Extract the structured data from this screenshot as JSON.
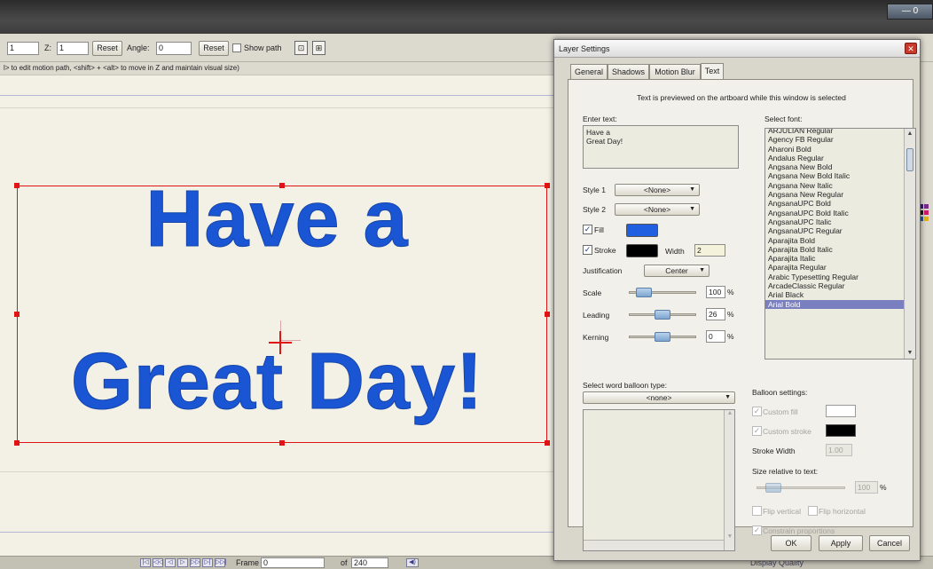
{
  "window": {
    "minimize_glyph": "—",
    "restore_glyph": "0"
  },
  "toolbar": {
    "field_1_value": "1",
    "z_label": "Z:",
    "z_value": "1",
    "reset_label": "Reset",
    "angle_label": "Angle:",
    "angle_value": "0",
    "reset2_label": "Reset",
    "show_path_label": "Show path",
    "hint": "l> to edit motion path, <shift> + <alt> to move in Z and maintain visual size)"
  },
  "artboard": {
    "line1": "Have a",
    "line2": "Great Day!",
    "text_color": "#1a55d4",
    "selection_color": "#e01414"
  },
  "playback": {
    "frame_label": "Frame",
    "frame_value": "0",
    "of_label": "of",
    "total_frames": "240",
    "display_quality_label": "Display Quality"
  },
  "dialog": {
    "title": "Layer Settings",
    "tabs": [
      "General",
      "Shadows",
      "Motion Blur",
      "Text"
    ],
    "active_tab": "Text",
    "info": "Text is previewed on the artboard while this window is selected",
    "enter_text_label": "Enter text:",
    "enter_text_lines": [
      "Have a",
      "Great Day!"
    ],
    "style1_label": "Style 1",
    "style1_value": "<None>",
    "style2_label": "Style 2",
    "style2_value": "<None>",
    "fill_label": "Fill",
    "fill_color": "#1f5fe0",
    "stroke_label": "Stroke",
    "stroke_color": "#000000",
    "width_label": "Width",
    "width_value": "2",
    "justification_label": "Justification",
    "justification_value": "Center",
    "scale_label": "Scale",
    "scale_value": "100",
    "leading_label": "Leading",
    "leading_value": "26",
    "kerning_label": "Kerning",
    "kerning_value": "0",
    "percent": "%",
    "select_font_label": "Select font:",
    "fonts": [
      "ARJULIAN Regular",
      "Agency FB Regular",
      "Aharoni Bold",
      "Andalus Regular",
      "Angsana New Bold",
      "Angsana New Bold Italic",
      "Angsana New Italic",
      "Angsana New Regular",
      "AngsanaUPC Bold",
      "AngsanaUPC Bold Italic",
      "AngsanaUPC Italic",
      "AngsanaUPC Regular",
      "Aparajita Bold",
      "Aparajita Bold Italic",
      "Aparajita Italic",
      "Aparajita Regular",
      "Arabic Typesetting Regular",
      "ArcadeClassic Regular",
      "Arial Black",
      "Arial Bold"
    ],
    "selected_font": "Arial Bold",
    "balloon_type_label": "Select word balloon type:",
    "balloon_type_value": "<none>",
    "balloon_settings_label": "Balloon settings:",
    "custom_fill_label": "Custom fill",
    "custom_stroke_label": "Custom stroke",
    "stroke_width_label": "Stroke Width",
    "stroke_width_value": "1.00",
    "size_relative_label": "Size relative to text:",
    "size_relative_value": "100",
    "flip_vertical_label": "Flip vertical",
    "flip_horizontal_label": "Flip horizontal",
    "constrain_label": "Constrain proportions",
    "ok_label": "OK",
    "apply_label": "Apply",
    "cancel_label": "Cancel"
  }
}
